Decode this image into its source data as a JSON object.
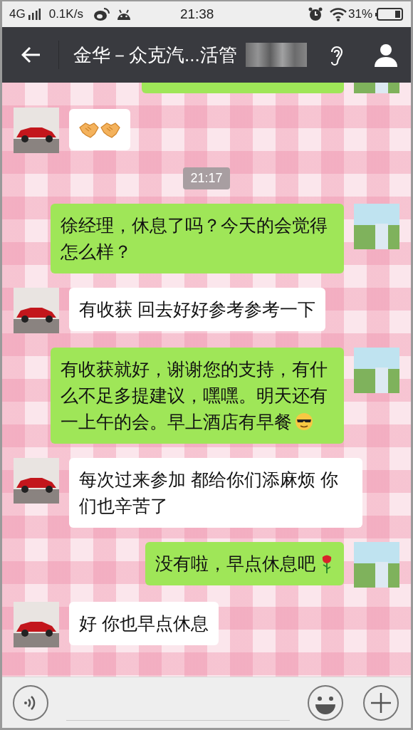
{
  "status_bar": {
    "network": "4G",
    "speed": "0.1K/s",
    "time": "21:38",
    "battery": "31%"
  },
  "header": {
    "title": "金华－众克汽...活管",
    "name_blurred": true
  },
  "messages": [
    {
      "kind": "obscured",
      "outgoing": true
    },
    {
      "kind": "sticker",
      "outgoing": false
    },
    {
      "kind": "time",
      "text": "21:17"
    },
    {
      "kind": "text",
      "outgoing": true,
      "parts": [
        {
          "kind": "text",
          "text": "徐经理，休息了吗？今天的会觉得怎么样？"
        }
      ]
    },
    {
      "kind": "text",
      "outgoing": false,
      "parts": [
        {
          "kind": "text",
          "text": "有收获 回去好好参考参考一下"
        }
      ]
    },
    {
      "kind": "text",
      "outgoing": true,
      "parts": [
        {
          "kind": "text",
          "text": "有收获就好，谢谢您的支持，有什么不足多提建议，嘿嘿。明天还有一上午的会。早上酒店有早餐"
        },
        {
          "kind": "sunglasses"
        }
      ]
    },
    {
      "kind": "text",
      "outgoing": false,
      "parts": [
        {
          "kind": "text",
          "text": "每次过来参加 都给你们添麻烦 你们也辛苦了"
        }
      ]
    },
    {
      "kind": "text",
      "outgoing": true,
      "parts": [
        {
          "kind": "text",
          "text": "没有啦，早点休息吧"
        },
        {
          "kind": "rose"
        }
      ]
    },
    {
      "kind": "text",
      "outgoing": false,
      "parts": [
        {
          "kind": "text",
          "text": "好 你也早点休息"
        }
      ]
    }
  ]
}
